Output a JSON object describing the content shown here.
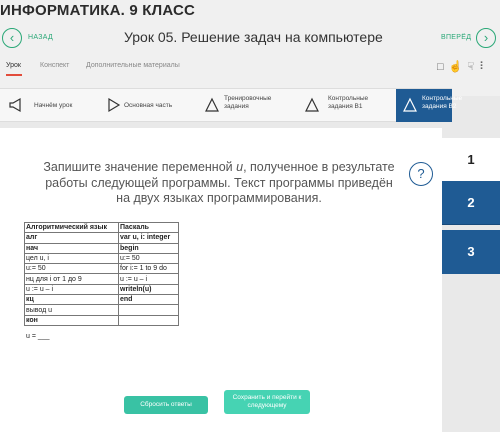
{
  "header": {
    "course": "ИНФОРМАТИКА. 9 КЛАСС",
    "back_label": "НАЗАД",
    "forward_label": "ВПЕРЁД",
    "lesson_title": "Урок 05. Решение задач на компьютере"
  },
  "tabs": [
    {
      "label": "Урок",
      "active": true
    },
    {
      "label": "Конспект",
      "active": false
    },
    {
      "label": "Дополнительные материалы",
      "active": false
    }
  ],
  "steps": [
    {
      "label1": "Начнём урок",
      "label2": "",
      "icon": "megaphone-icon"
    },
    {
      "label1": "Основная часть",
      "label2": "",
      "icon": "play-icon"
    },
    {
      "label1": "Тренировочные",
      "label2": "задания",
      "icon": "triangle-icon"
    },
    {
      "label1": "Контрольные",
      "label2": "задания В1",
      "icon": "triangle-icon"
    },
    {
      "label1": "Контрольные",
      "label2": "задания В2",
      "icon": "triangle-icon",
      "active": true
    }
  ],
  "side_tabs": [
    "1",
    "2",
    "3"
  ],
  "question": {
    "line1_a": "Запишите значение переменной ",
    "line1_var": "u",
    "line1_b": ", полученное в результате",
    "line2": "работы следующей программы. Текст программы приведён",
    "line3": "на двух языках программирования."
  },
  "table": {
    "header": [
      "Алгоритмический язык",
      "Паскаль"
    ],
    "rows": [
      {
        "a": "алг",
        "p": "var u, i: integer"
      },
      {
        "a": "нач",
        "p": "begin"
      },
      {
        "a": "цел u, i",
        "p": "u:= 50"
      },
      {
        "a": "u:= 50",
        "p": "for i:= 1 to 9 do"
      },
      {
        "a": "нц для i от 1 до 9",
        "p": "u := u – i"
      },
      {
        "a": "u := u – i",
        "p": "writeln(u)"
      },
      {
        "a": "кц",
        "p": "end"
      },
      {
        "a": "вывод u",
        "p": ""
      },
      {
        "a": "кон",
        "p": ""
      }
    ]
  },
  "answer_label": "u = ___",
  "buttons": {
    "reset": "Сбросить ответы",
    "save_line1": "Сохранить и перейти к",
    "save_line2": "следующему"
  },
  "colors": {
    "accent_green": "#2aa877",
    "active_blue": "#1f5b94",
    "button_teal": "#39c2a4",
    "tab_underline": "#e24c3b"
  }
}
